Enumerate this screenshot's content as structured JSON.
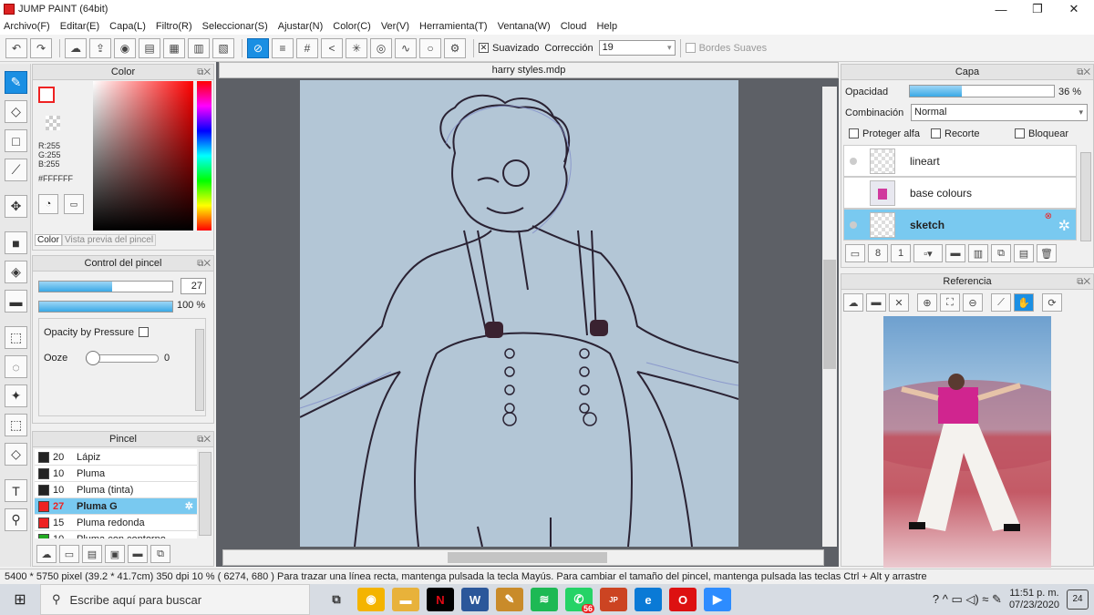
{
  "window": {
    "title": "JUMP PAINT (64bit)",
    "min": "—",
    "max": "❐",
    "close": "✕"
  },
  "menu": [
    "Archivo(F)",
    "Editar(E)",
    "Capa(L)",
    "Filtro(R)",
    "Seleccionar(S)",
    "Ajustar(N)",
    "Color(C)",
    "Ver(V)",
    "Herramienta(T)",
    "Ventana(W)",
    "Cloud",
    "Help"
  ],
  "toolbar": {
    "smoothing_label": "Suavizado",
    "correction_label": "Corrección",
    "correction_value": "19",
    "soft_edges_label": "Bordes Suaves"
  },
  "color_panel": {
    "title": "Color",
    "r": "R:255",
    "g": "G:255",
    "b": "B:255",
    "hex": "#FFFFFF",
    "tab_color": "Color",
    "tab_preview": "Vista previa del pincel"
  },
  "brush_control": {
    "title": "Control del pincel",
    "size": "27",
    "opacity": "100 %",
    "opacity_by_pressure": "Opacity by Pressure",
    "ooze_label": "Ooze",
    "ooze_value": "0"
  },
  "brush_list": {
    "title": "Pincel",
    "items": [
      {
        "size": "20",
        "name": "Lápiz",
        "color": "#222222"
      },
      {
        "size": "10",
        "name": "Pluma",
        "color": "#222222"
      },
      {
        "size": "10",
        "name": "Pluma (tinta)",
        "color": "#222222"
      },
      {
        "size": "27",
        "name": "Pluma G",
        "color": "#ee2222",
        "selected": true
      },
      {
        "size": "15",
        "name": "Pluma redonda",
        "color": "#ee2222"
      },
      {
        "size": "10",
        "name": "Pluma con contorno",
        "color": "#22aa22"
      }
    ]
  },
  "document": {
    "tab": "harry styles.mdp"
  },
  "layer_panel": {
    "title": "Capa",
    "opacity_label": "Opacidad",
    "opacity_value": "36 %",
    "opacity_fraction": 0.36,
    "blend_label": "Combinación",
    "blend_value": "Normal",
    "protect_alpha": "Proteger alfa",
    "clipping": "Recorte",
    "lock": "Bloquear",
    "layers": [
      {
        "name": "lineart"
      },
      {
        "name": "base colours"
      },
      {
        "name": "sketch",
        "selected": true
      }
    ]
  },
  "reference_panel": {
    "title": "Referencia"
  },
  "status": {
    "text": "5400 * 5750 pixel   (39.2 * 41.7cm)   350 dpi   10 %   ( 6274, 680 )   Para trazar una línea recta, mantenga pulsada la tecla Mayús. Para cambiar el tamaño del pincel, mantenga pulsada las teclas Ctrl + Alt y arrastre"
  },
  "taskbar": {
    "search_placeholder": "Escribe aquí para buscar",
    "time": "11:51 p. m.",
    "date": "07/23/2020",
    "badge": "56",
    "notif": "24"
  },
  "colors": {
    "accent": "#1a8fe3",
    "selected_row": "#79c9f0",
    "paper": "#b3c6d6",
    "canvas_bg": "#5d6066"
  }
}
